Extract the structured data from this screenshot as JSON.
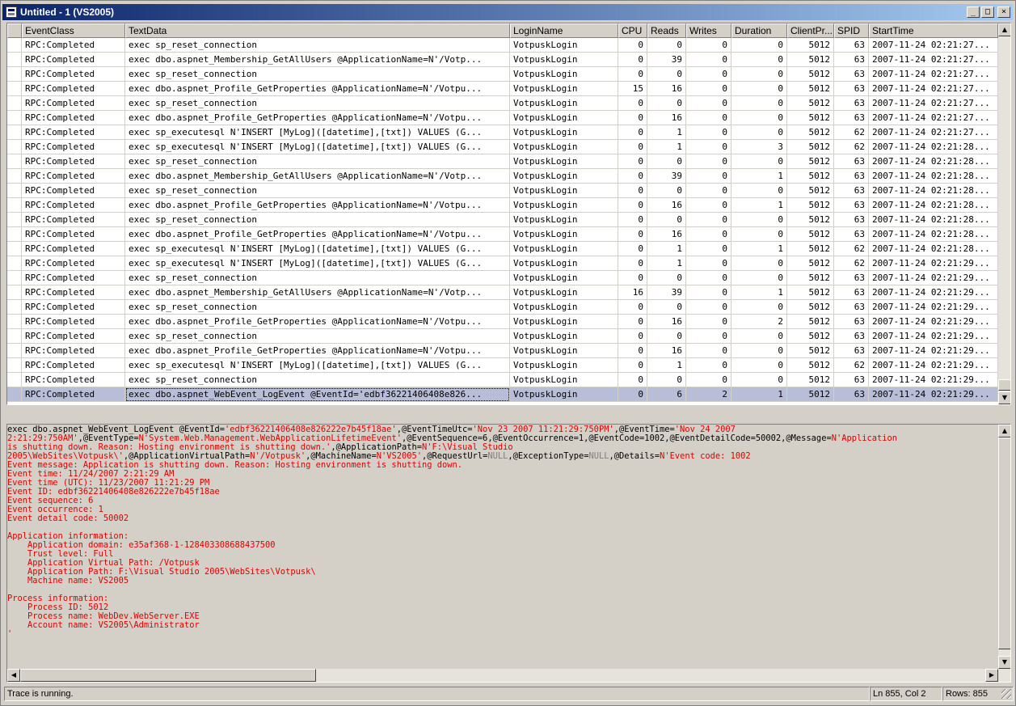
{
  "window": {
    "title": "Untitled - 1 (VS2005)",
    "min_glyph": "_",
    "max_glyph": "□",
    "close_glyph": "×"
  },
  "grid": {
    "columns": [
      "EventClass",
      "TextData",
      "LoginName",
      "CPU",
      "Reads",
      "Writes",
      "Duration",
      "ClientPr...",
      "SPID",
      "StartTime"
    ],
    "rows": [
      [
        "RPC:Completed",
        "exec sp_reset_connection",
        "VotpuskLogin",
        "0",
        "0",
        "0",
        "0",
        "5012",
        "63",
        "2007-11-24 02:21:27..."
      ],
      [
        "RPC:Completed",
        "exec dbo.aspnet_Membership_GetAllUsers @ApplicationName=N'/Votp...",
        "VotpuskLogin",
        "0",
        "39",
        "0",
        "0",
        "5012",
        "63",
        "2007-11-24 02:21:27..."
      ],
      [
        "RPC:Completed",
        "exec sp_reset_connection",
        "VotpuskLogin",
        "0",
        "0",
        "0",
        "0",
        "5012",
        "63",
        "2007-11-24 02:21:27..."
      ],
      [
        "RPC:Completed",
        "exec dbo.aspnet_Profile_GetProperties @ApplicationName=N'/Votpu...",
        "VotpuskLogin",
        "15",
        "16",
        "0",
        "0",
        "5012",
        "63",
        "2007-11-24 02:21:27..."
      ],
      [
        "RPC:Completed",
        "exec sp_reset_connection",
        "VotpuskLogin",
        "0",
        "0",
        "0",
        "0",
        "5012",
        "63",
        "2007-11-24 02:21:27..."
      ],
      [
        "RPC:Completed",
        "exec dbo.aspnet_Profile_GetProperties @ApplicationName=N'/Votpu...",
        "VotpuskLogin",
        "0",
        "16",
        "0",
        "0",
        "5012",
        "63",
        "2007-11-24 02:21:27..."
      ],
      [
        "RPC:Completed",
        "exec sp_executesql N'INSERT [MyLog]([datetime],[txt]) VALUES (G...",
        "VotpuskLogin",
        "0",
        "1",
        "0",
        "0",
        "5012",
        "62",
        "2007-11-24 02:21:27..."
      ],
      [
        "RPC:Completed",
        "exec sp_executesql N'INSERT [MyLog]([datetime],[txt]) VALUES (G...",
        "VotpuskLogin",
        "0",
        "1",
        "0",
        "3",
        "5012",
        "62",
        "2007-11-24 02:21:28..."
      ],
      [
        "RPC:Completed",
        "exec sp_reset_connection",
        "VotpuskLogin",
        "0",
        "0",
        "0",
        "0",
        "5012",
        "63",
        "2007-11-24 02:21:28..."
      ],
      [
        "RPC:Completed",
        "exec dbo.aspnet_Membership_GetAllUsers @ApplicationName=N'/Votp...",
        "VotpuskLogin",
        "0",
        "39",
        "0",
        "1",
        "5012",
        "63",
        "2007-11-24 02:21:28..."
      ],
      [
        "RPC:Completed",
        "exec sp_reset_connection",
        "VotpuskLogin",
        "0",
        "0",
        "0",
        "0",
        "5012",
        "63",
        "2007-11-24 02:21:28..."
      ],
      [
        "RPC:Completed",
        "exec dbo.aspnet_Profile_GetProperties @ApplicationName=N'/Votpu...",
        "VotpuskLogin",
        "0",
        "16",
        "0",
        "1",
        "5012",
        "63",
        "2007-11-24 02:21:28..."
      ],
      [
        "RPC:Completed",
        "exec sp_reset_connection",
        "VotpuskLogin",
        "0",
        "0",
        "0",
        "0",
        "5012",
        "63",
        "2007-11-24 02:21:28..."
      ],
      [
        "RPC:Completed",
        "exec dbo.aspnet_Profile_GetProperties @ApplicationName=N'/Votpu...",
        "VotpuskLogin",
        "0",
        "16",
        "0",
        "0",
        "5012",
        "63",
        "2007-11-24 02:21:28..."
      ],
      [
        "RPC:Completed",
        "exec sp_executesql N'INSERT [MyLog]([datetime],[txt]) VALUES (G...",
        "VotpuskLogin",
        "0",
        "1",
        "0",
        "1",
        "5012",
        "62",
        "2007-11-24 02:21:28..."
      ],
      [
        "RPC:Completed",
        "exec sp_executesql N'INSERT [MyLog]([datetime],[txt]) VALUES (G...",
        "VotpuskLogin",
        "0",
        "1",
        "0",
        "0",
        "5012",
        "62",
        "2007-11-24 02:21:29..."
      ],
      [
        "RPC:Completed",
        "exec sp_reset_connection",
        "VotpuskLogin",
        "0",
        "0",
        "0",
        "0",
        "5012",
        "63",
        "2007-11-24 02:21:29..."
      ],
      [
        "RPC:Completed",
        "exec dbo.aspnet_Membership_GetAllUsers @ApplicationName=N'/Votp...",
        "VotpuskLogin",
        "16",
        "39",
        "0",
        "1",
        "5012",
        "63",
        "2007-11-24 02:21:29..."
      ],
      [
        "RPC:Completed",
        "exec sp_reset_connection",
        "VotpuskLogin",
        "0",
        "0",
        "0",
        "0",
        "5012",
        "63",
        "2007-11-24 02:21:29..."
      ],
      [
        "RPC:Completed",
        "exec dbo.aspnet_Profile_GetProperties @ApplicationName=N'/Votpu...",
        "VotpuskLogin",
        "0",
        "16",
        "0",
        "2",
        "5012",
        "63",
        "2007-11-24 02:21:29..."
      ],
      [
        "RPC:Completed",
        "exec sp_reset_connection",
        "VotpuskLogin",
        "0",
        "0",
        "0",
        "0",
        "5012",
        "63",
        "2007-11-24 02:21:29..."
      ],
      [
        "RPC:Completed",
        "exec dbo.aspnet_Profile_GetProperties @ApplicationName=N'/Votpu...",
        "VotpuskLogin",
        "0",
        "16",
        "0",
        "0",
        "5012",
        "63",
        "2007-11-24 02:21:29..."
      ],
      [
        "RPC:Completed",
        "exec sp_executesql N'INSERT [MyLog]([datetime],[txt]) VALUES (G...",
        "VotpuskLogin",
        "0",
        "1",
        "0",
        "0",
        "5012",
        "62",
        "2007-11-24 02:21:29..."
      ],
      [
        "RPC:Completed",
        "exec sp_reset_connection",
        "VotpuskLogin",
        "0",
        "0",
        "0",
        "0",
        "5012",
        "63",
        "2007-11-24 02:21:29..."
      ],
      [
        "RPC:Completed",
        "exec dbo.aspnet_WebEvent_LogEvent @EventId='edbf36221406408e826...",
        "VotpuskLogin",
        "0",
        "6",
        "2",
        "1",
        "5012",
        "63",
        "2007-11-24 02:21:29..."
      ]
    ],
    "selected_row": 24
  },
  "textdata": {
    "lines": [
      [
        [
          "k",
          "exec dbo.aspnet_WebEvent_LogEvent @EventId="
        ],
        [
          "r",
          "'edbf36221406408e826222e7b45f18ae'"
        ],
        [
          "k",
          ",@EventTimeUtc="
        ],
        [
          "r",
          "'Nov 23 2007 11:21:29:750PM'"
        ],
        [
          "k",
          ",@EventTime="
        ],
        [
          "r",
          "'Nov 24 2007"
        ]
      ],
      [
        [
          "r",
          "2:21:29:750AM'"
        ],
        [
          "k",
          ",@EventType="
        ],
        [
          "r",
          "N'System.Web.Management.WebApplicationLifetimeEvent'"
        ],
        [
          "k",
          ",@EventSequence=6,@EventOccurrence=1,@EventCode=1002,@EventDetailCode=50002,@Message="
        ],
        [
          "r",
          "N'Application"
        ]
      ],
      [
        [
          "r",
          "is shutting down. Reason: Hosting environment is shutting down.'"
        ],
        [
          "k",
          ",@ApplicationPath="
        ],
        [
          "r",
          "N'F:\\Visual Studio"
        ]
      ],
      [
        [
          "r",
          "2005\\WebSites\\Votpusk\\'"
        ],
        [
          "k",
          ",@ApplicationVirtualPath="
        ],
        [
          "r",
          "N'/Votpusk'"
        ],
        [
          "k",
          ",@MachineName="
        ],
        [
          "r",
          "N'VS2005'"
        ],
        [
          "k",
          ",@RequestUrl="
        ],
        [
          "g",
          "NULL"
        ],
        [
          "k",
          ",@ExceptionType="
        ],
        [
          "g",
          "NULL"
        ],
        [
          "k",
          ",@Details="
        ],
        [
          "r",
          "N'Event code: 1002"
        ]
      ],
      [
        [
          "r",
          "Event message: Application is shutting down. Reason: Hosting environment is shutting down."
        ]
      ],
      [
        [
          "r",
          "Event time: 11/24/2007 2:21:29 AM"
        ]
      ],
      [
        [
          "r",
          "Event time (UTC): 11/23/2007 11:21:29 PM"
        ]
      ],
      [
        [
          "r",
          "Event ID: edbf36221406408e826222e7b45f18ae"
        ]
      ],
      [
        [
          "r",
          "Event sequence: 6"
        ]
      ],
      [
        [
          "r",
          "Event occurrence: 1"
        ]
      ],
      [
        [
          "r",
          "Event detail code: 50002"
        ]
      ],
      [
        [
          "r",
          ""
        ]
      ],
      [
        [
          "r",
          "Application information:"
        ]
      ],
      [
        [
          "r",
          "    Application domain: e35af368-1-128403308688437500"
        ]
      ],
      [
        [
          "r",
          "    Trust level: Full"
        ]
      ],
      [
        [
          "r",
          "    Application Virtual Path: /Votpusk"
        ]
      ],
      [
        [
          "r",
          "    Application Path: F:\\Visual Studio 2005\\WebSites\\Votpusk\\"
        ]
      ],
      [
        [
          "r",
          "    Machine name: VS2005"
        ]
      ],
      [
        [
          "r",
          ""
        ]
      ],
      [
        [
          "r",
          "Process information:"
        ]
      ],
      [
        [
          "r",
          "    Process ID: 5012"
        ]
      ],
      [
        [
          "r",
          "    Process name: WebDev.WebServer.EXE"
        ]
      ],
      [
        [
          "r",
          "    Account name: VS2005\\Administrator"
        ]
      ],
      [
        [
          "r",
          "'"
        ]
      ]
    ]
  },
  "statusbar": {
    "status": "Trace is running.",
    "position": "Ln 855, Col 2",
    "rows": "Rows: 855"
  },
  "icons": [
    "app-icon",
    "minimize-icon",
    "maximize-icon",
    "close-icon",
    "scroll-up-icon",
    "scroll-down-icon",
    "scroll-left-icon",
    "scroll-right-icon",
    "resize-grip-icon"
  ],
  "colors": {
    "title_start": "#0a246a",
    "title_end": "#a6caf0",
    "selection": "#b9bed8",
    "sql_string": "#e00000",
    "sql_null": "#808080"
  }
}
